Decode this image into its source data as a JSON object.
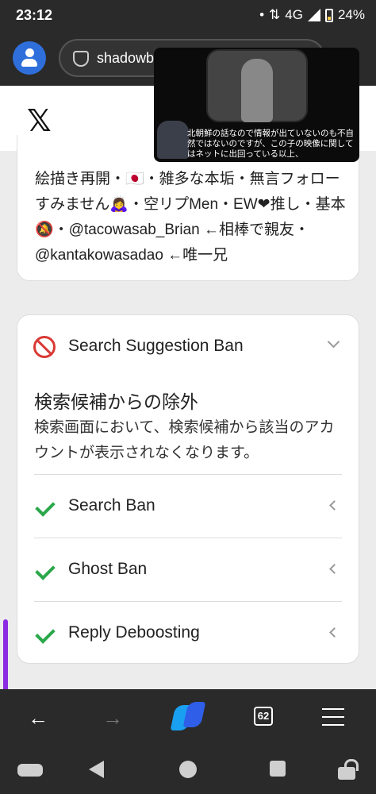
{
  "status_bar": {
    "time": "23:12",
    "network": "4G",
    "battery": "24%"
  },
  "browser": {
    "url": "shadowb"
  },
  "profile": {
    "bio": "絵描き再開・🇯🇵・雑多な本垢・無言フォローすみません🙇‍♀️・空リプMen・EW❤推し・基本🔕・@tacowasab_Brian ←相棒で親友・@kantakowasadao ←唯一兄"
  },
  "video_overlay": {
    "caption": "北朝鮮の話なので情報が出ていないのも不自然ではないのですが、この子の映像に関してはネットに出回っている以上、"
  },
  "ban_card": {
    "title": "Search Suggestion Ban",
    "heading": "検索候補からの除外",
    "description": "検索画面において、検索候補から該当のアカウントが表示されなくなります。",
    "rows": [
      {
        "label": "Search Ban"
      },
      {
        "label": "Ghost Ban"
      },
      {
        "label": "Reply Deboosting"
      }
    ]
  },
  "nav_bar": {
    "tab_count": "62",
    "back_glyph": "←",
    "forward_glyph": "→"
  },
  "colors": {
    "prohibit": "#d93a36",
    "check": "#2aa84a",
    "scroll_indicator": "#8b2be2"
  }
}
